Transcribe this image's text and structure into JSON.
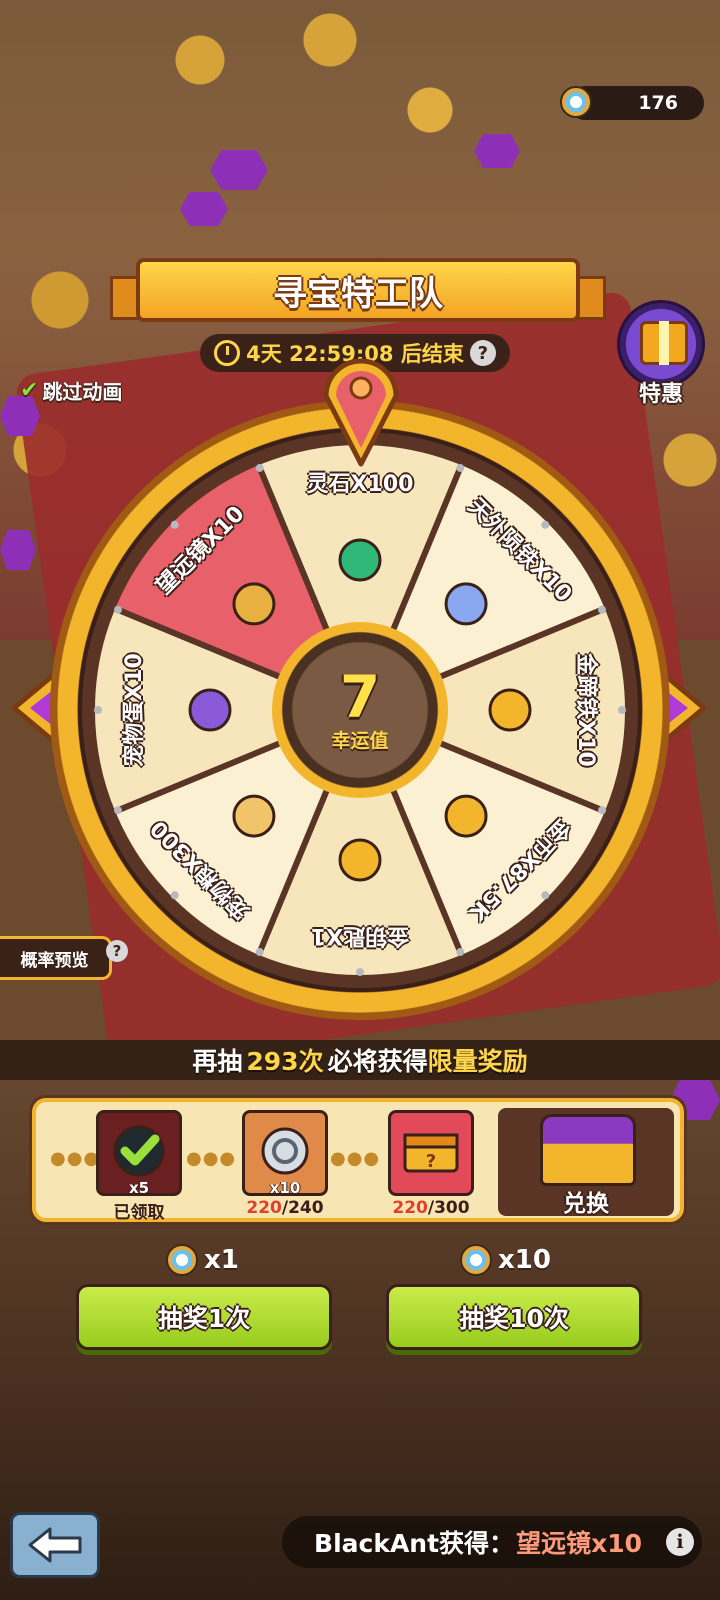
{
  "currency": {
    "value": "176",
    "icon": "compass-icon"
  },
  "title": "寻宝特工队",
  "timer": {
    "text": "4天 22:59:08 后结束",
    "help": "?"
  },
  "skip_animation": "跳过动画",
  "special_offer": "特惠",
  "wheel": {
    "luck_value": "7",
    "luck_label": "幸运值",
    "segments": [
      {
        "label": "灵石X100",
        "icon": "spirit-stone-icon",
        "color": "#f7e6bc"
      },
      {
        "label": "天外陨铁X10",
        "icon": "meteorite-icon",
        "color": "#fbf0d2"
      },
      {
        "label": "金蹄铁X10",
        "icon": "horseshoe-icon",
        "color": "#f7e6bc"
      },
      {
        "label": "金币X87.5K",
        "icon": "gold-coin-icon",
        "color": "#fbf0d2"
      },
      {
        "label": "金钥匙X1",
        "icon": "key-icon",
        "color": "#f7e6bc"
      },
      {
        "label": "宠物粮X300",
        "icon": "bone-icon",
        "color": "#fbf0d2"
      },
      {
        "label": "宠物蛋X10",
        "icon": "pet-egg-icon",
        "color": "#f7e6bc"
      },
      {
        "label": "望远镜X10",
        "icon": "telescope-icon",
        "color": "#e8606a"
      }
    ]
  },
  "probability_preview": "概率预览",
  "guarantee": {
    "prefix": "再抽",
    "count": "293次",
    "middle": " 必将获得",
    "reward": "限量奖励"
  },
  "milestones": [
    {
      "count": "x5",
      "status": "已领取",
      "icon": "check-icon"
    },
    {
      "count": "x10",
      "current": "220",
      "total": "/240",
      "icon": "silver-coin-icon"
    },
    {
      "count": "",
      "current": "220",
      "total": "/300",
      "icon": "mystery-chest-icon"
    }
  ],
  "exchange_label": "兑换",
  "draw": {
    "single_cost": "x1",
    "multi_cost": "x10",
    "single_label": "抽奖1次",
    "multi_label": "抽奖10次"
  },
  "ticker": {
    "player": "BlackAnt获得：",
    "prize": "望远镜x10",
    "info": "i"
  }
}
